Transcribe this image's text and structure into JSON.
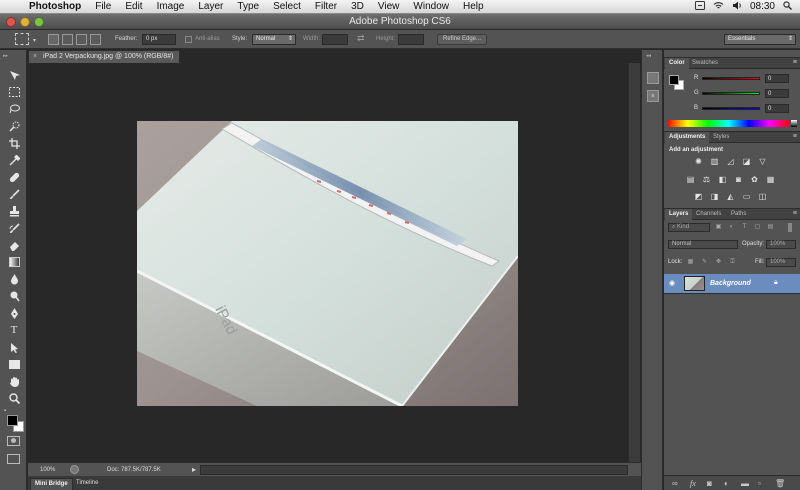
{
  "menubar": {
    "items": [
      "Photoshop",
      "File",
      "Edit",
      "Image",
      "Layer",
      "Type",
      "Select",
      "Filter",
      "3D",
      "View",
      "Window",
      "Help"
    ],
    "clock": "08:30"
  },
  "window": {
    "title": "Adobe Photoshop CS6"
  },
  "options": {
    "feather_label": "Feather:",
    "feather_value": "0 px",
    "antialias_label": "Anti-alias",
    "style_label": "Style:",
    "style_value": "Normal",
    "width_label": "Width:",
    "height_label": "Height:",
    "refine_edge": "Refine Edge...",
    "workspace": "Essentials"
  },
  "document": {
    "tab_title": "iPad 2 Verpackung.jpg @ 100% (RGB/8#)",
    "close_glyph": "×",
    "photo_text": "iPad"
  },
  "status": {
    "zoom": "100%",
    "doc_info": "Doc: 787.5K/787.5K"
  },
  "bottom_tabs": [
    "Mini Bridge",
    "Timeline"
  ],
  "color_panel": {
    "tabs": [
      "Color",
      "Swatches"
    ],
    "channels": [
      {
        "label": "R",
        "value": "0"
      },
      {
        "label": "G",
        "value": "0"
      },
      {
        "label": "B",
        "value": "0"
      }
    ]
  },
  "adjustments_panel": {
    "tabs": [
      "Adjustments",
      "Styles"
    ],
    "heading": "Add an adjustment"
  },
  "layers_panel": {
    "tabs": [
      "Layers",
      "Channels",
      "Paths"
    ],
    "kind": "Kind",
    "blend_mode": "Normal",
    "opacity_label": "Opacity:",
    "opacity_value": "100%",
    "lock_label": "Lock:",
    "fill_label": "Fill:",
    "fill_value": "100%",
    "layers": [
      {
        "name": "Background"
      }
    ]
  },
  "colors": {
    "accent_selected_layer": "#6b8cbf",
    "panel_bg": "#535353",
    "canvas_bg": "#282828"
  }
}
